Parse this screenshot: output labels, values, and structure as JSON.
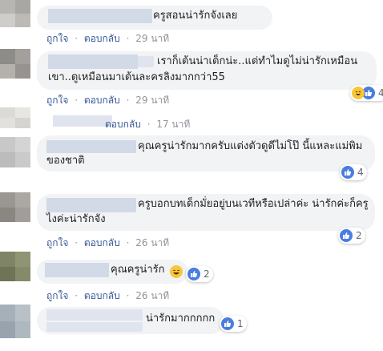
{
  "comments": [
    {
      "text_lines": [
        "ครูสอนน่ารักจังเลย"
      ],
      "like": "ถูกใจ",
      "reply": "ตอบกลับ",
      "time": "29 นาที",
      "reactions": null
    },
    {
      "text_lines": [
        "เราก็เต้นน่าเต็กน่ะ..แต่ทำไมดูไม่น่ารักเหมือน",
        "เขา..ดูเหมือนมาเต้นละครลิงมากกว่า55"
      ],
      "like": "ถูกใจ",
      "reply": "ตอบกลับ",
      "time": "29 นาที",
      "reactions": "4"
    },
    {
      "text_lines": [],
      "like": "",
      "reply": "ตอบกลับ",
      "time": "17 นาที",
      "reactions": null
    },
    {
      "text_lines": [
        "คุณครูน่ารักมากครับแต่งตัวดูดีไม่โป๊ นี้แหละแม่พิม",
        "ของชาติ"
      ],
      "like": "",
      "reply": "",
      "time": "",
      "reactions": "4"
    },
    {
      "text_lines": [
        "ครูบอกบทเด็กมั่ยอยู่บนเวทีหรือเปล่าค่ะ น่ารักค่ะก็ครู",
        "ไงค่ะน่ารักจัง"
      ],
      "like": "ถูกใจ",
      "reply": "ตอบกลับ",
      "time": "26 นาที",
      "reactions": "2"
    },
    {
      "text_lines": [
        "คุณครูน่ารัก"
      ],
      "like": "ถูกใจ",
      "reply": "ตอบกลับ",
      "time": "26 นาที",
      "reactions": "2"
    },
    {
      "text_lines": [
        "น่ารักมากกกกก"
      ],
      "like": "",
      "reply": "",
      "time": "",
      "reactions": "1"
    }
  ],
  "separator": "·",
  "colors": {
    "link": "#385898",
    "bubble": "#f2f3f5",
    "like": "#4a7de0",
    "haha": "#f7c63b"
  },
  "icons": {
    "like": "like-icon",
    "haha": "haha-emoji-icon",
    "smile": "smile-emoji-icon"
  }
}
